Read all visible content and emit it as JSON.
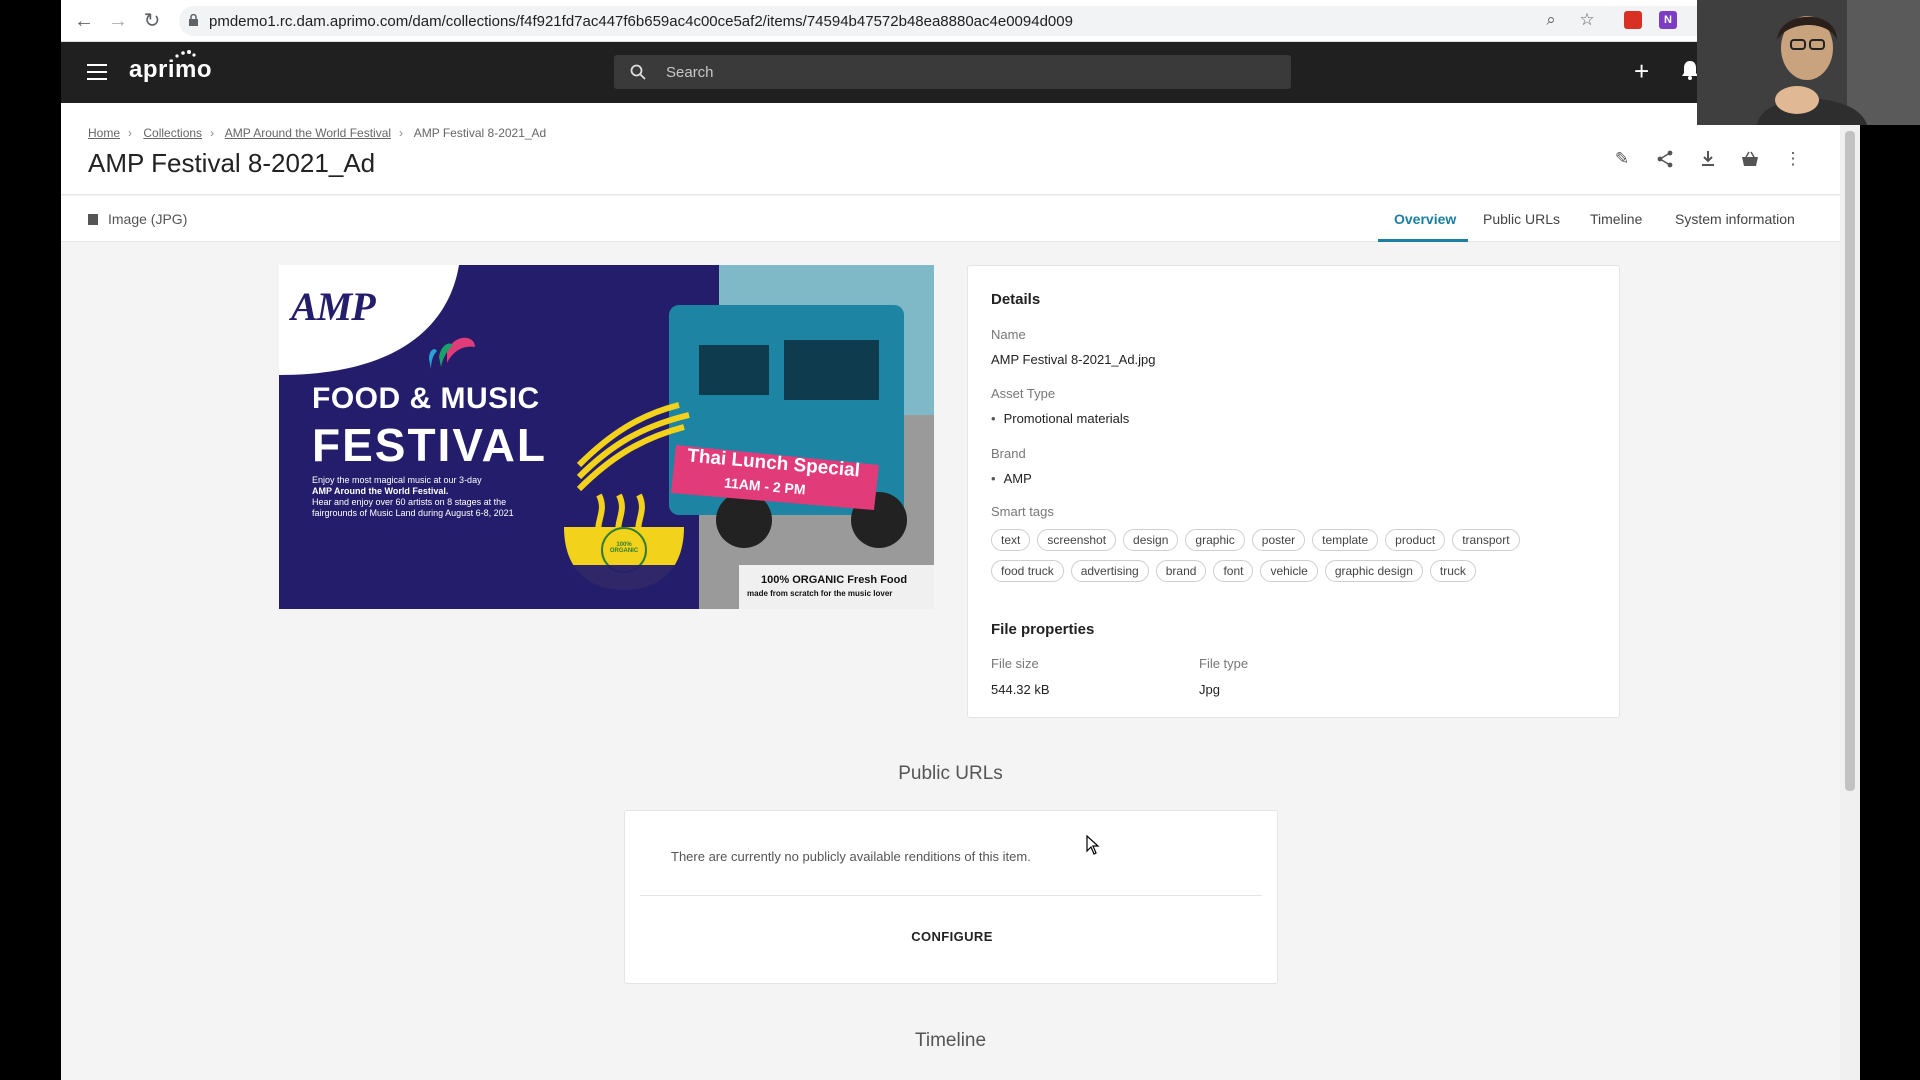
{
  "browser": {
    "url": "pmdemo1.rc.dam.aprimo.com/dam/collections/f4f921fd7ac447f6b659ac4c00ce5af2/items/74594b47572b48ea8880ac4e0094d009"
  },
  "app": {
    "logo_text": "aprimo",
    "search_placeholder": "Search"
  },
  "breadcrumb": {
    "items": [
      "Home",
      "Collections",
      "AMP Around the World Festival"
    ],
    "current": "AMP Festival 8-2021_Ad"
  },
  "page": {
    "title": "AMP Festival 8-2021_Ad",
    "file_type": "Image (JPG)"
  },
  "tabs": [
    "Overview",
    "Public URLs",
    "Timeline",
    "System information"
  ],
  "preview": {
    "brand": "AMP",
    "headline_1": "FOOD & MUSIC",
    "headline_2": "FESTIVAL",
    "body_1": "Enjoy the most magical music at our 3-day",
    "body_2": "AMP Around the World Festival.",
    "body_3": "Hear and enjoy over 60 artists on 8 stages at the",
    "body_4": "fairgrounds of Music Land during August 6-8, 2021",
    "special": "Thai Lunch Special",
    "special_time": "11AM - 2 PM",
    "bowl_text": "100% ORGANIC",
    "footer_1": "100% ORGANIC  Fresh Food",
    "footer_2": "made from scratch for the music lover"
  },
  "details": {
    "heading": "Details",
    "name_label": "Name",
    "name_value": "AMP Festival 8-2021_Ad.jpg",
    "asset_type_label": "Asset Type",
    "asset_type_value": "Promotional materials",
    "brand_label": "Brand",
    "brand_value": "AMP",
    "smart_tags_label": "Smart tags",
    "smart_tags": [
      "text",
      "screenshot",
      "design",
      "graphic",
      "poster",
      "template",
      "product",
      "transport",
      "food truck",
      "advertising",
      "brand",
      "font",
      "vehicle",
      "graphic design",
      "truck"
    ],
    "file_props_heading": "File properties",
    "file_size_label": "File size",
    "file_size_value": "544.32 kB",
    "file_type_label": "File type",
    "file_type_value": "Jpg"
  },
  "public_urls": {
    "heading": "Public URLs",
    "empty_message": "There are currently no publicly available renditions of this item.",
    "configure_label": "CONFIGURE"
  },
  "timeline": {
    "heading": "Timeline"
  },
  "colors": {
    "accent": "#1a7fa0",
    "header_bg": "#202020",
    "poster_navy": "#241d6b",
    "poster_pink": "#e23b7a",
    "poster_yellow": "#f2d21b"
  }
}
